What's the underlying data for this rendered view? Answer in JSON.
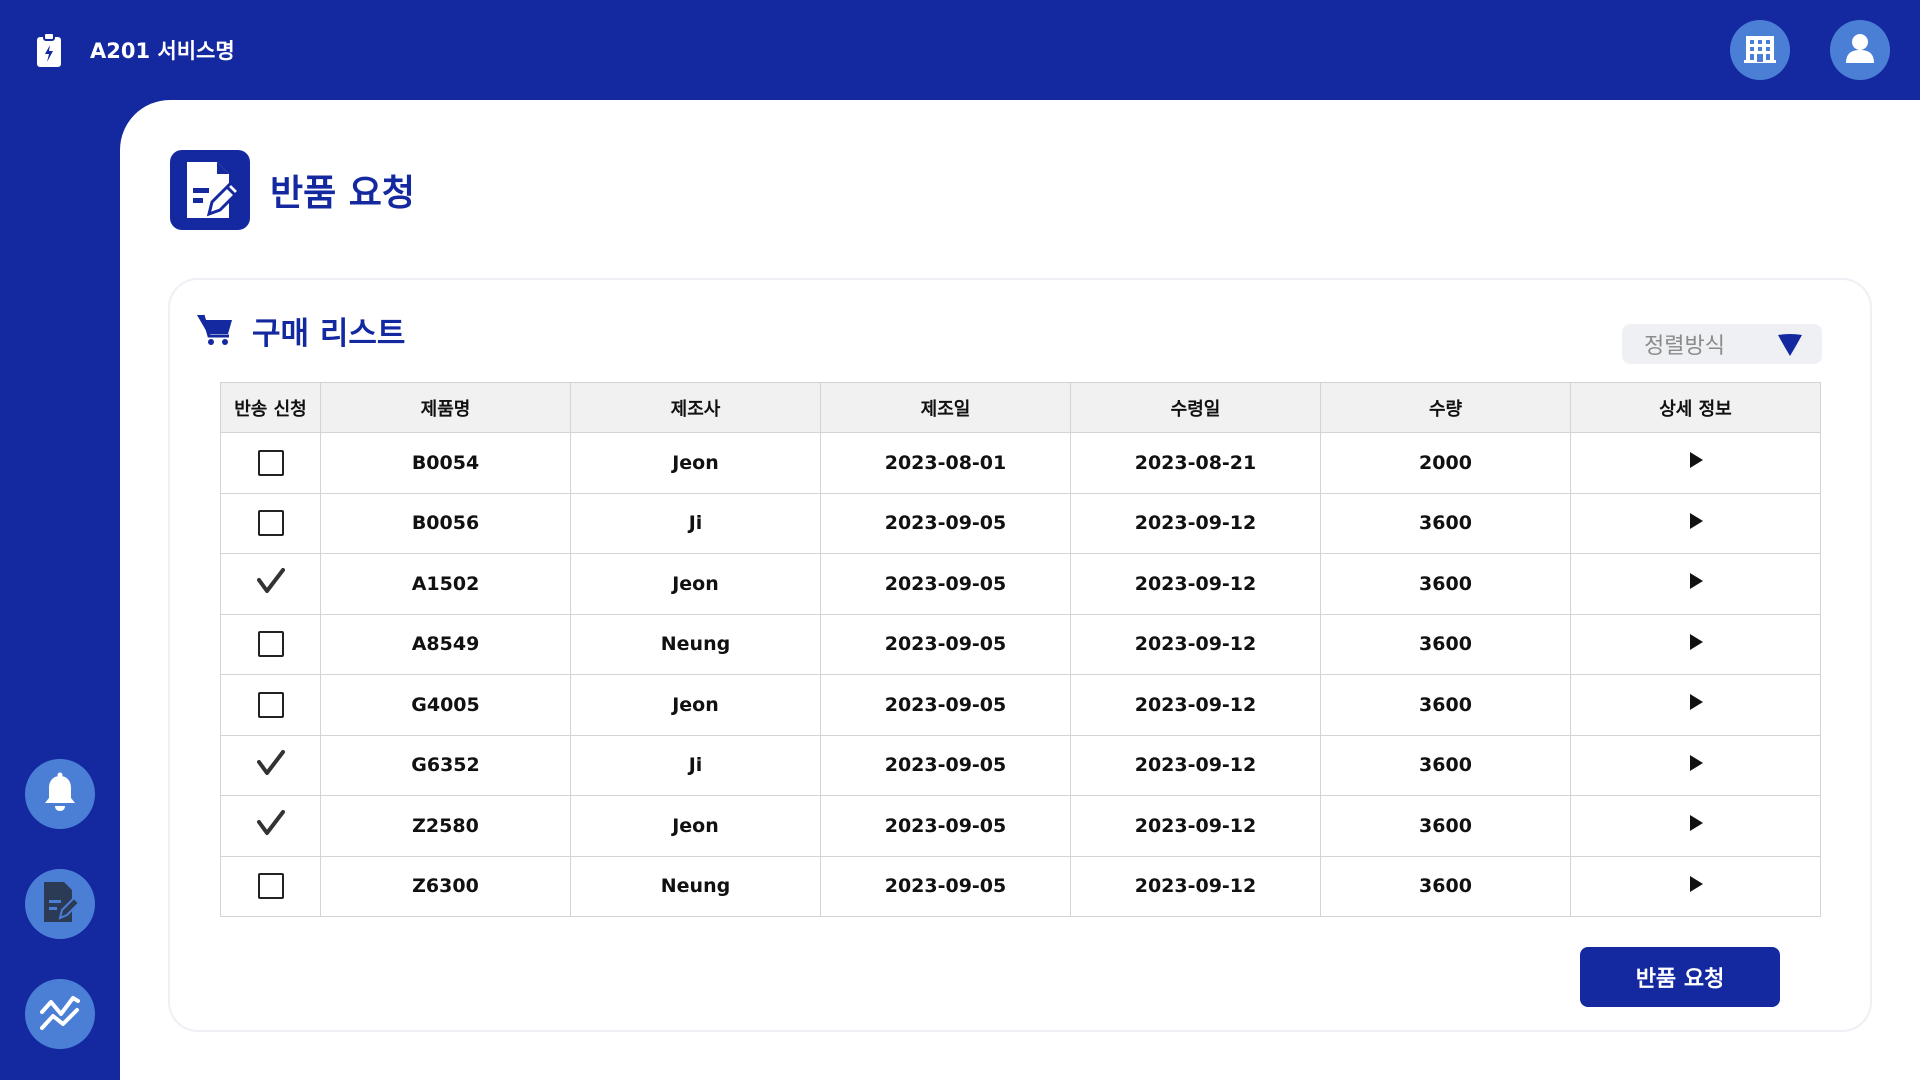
{
  "app": {
    "title": "A201 서비스명"
  },
  "page": {
    "title": "반품 요청"
  },
  "card": {
    "title": "구매 리스트"
  },
  "sort": {
    "label": "정렬방식"
  },
  "table": {
    "headers": [
      "반송 신청",
      "제품명",
      "제조사",
      "제조일",
      "수령일",
      "수량",
      "상세 정보"
    ],
    "rows": [
      {
        "checked": false,
        "product": "B0054",
        "maker": "Jeon",
        "made": "2023-08-01",
        "received": "2023-08-21",
        "qty": "2000"
      },
      {
        "checked": false,
        "product": "B0056",
        "maker": "Ji",
        "made": "2023-09-05",
        "received": "2023-09-12",
        "qty": "3600"
      },
      {
        "checked": true,
        "product": "A1502",
        "maker": "Jeon",
        "made": "2023-09-05",
        "received": "2023-09-12",
        "qty": "3600"
      },
      {
        "checked": false,
        "product": "A8549",
        "maker": "Neung",
        "made": "2023-09-05",
        "received": "2023-09-12",
        "qty": "3600"
      },
      {
        "checked": false,
        "product": "G4005",
        "maker": "Jeon",
        "made": "2023-09-05",
        "received": "2023-09-12",
        "qty": "3600"
      },
      {
        "checked": true,
        "product": "G6352",
        "maker": "Ji",
        "made": "2023-09-05",
        "received": "2023-09-12",
        "qty": "3600"
      },
      {
        "checked": true,
        "product": "Z2580",
        "maker": "Jeon",
        "made": "2023-09-05",
        "received": "2023-09-12",
        "qty": "3600"
      },
      {
        "checked": false,
        "product": "Z6300",
        "maker": "Neung",
        "made": "2023-09-05",
        "received": "2023-09-12",
        "qty": "3600"
      }
    ]
  },
  "actions": {
    "submit_label": "반품 요청"
  },
  "icons": {
    "brand": "clipboard-icon",
    "building": "building-icon",
    "user": "user-icon",
    "bell": "bell-icon",
    "document_edit": "document-edit-icon",
    "chart": "chart-icon",
    "cart": "cart-icon"
  },
  "colors": {
    "primary": "#1428a0",
    "accent": "#4b7fd6",
    "background": "#ffffff"
  }
}
